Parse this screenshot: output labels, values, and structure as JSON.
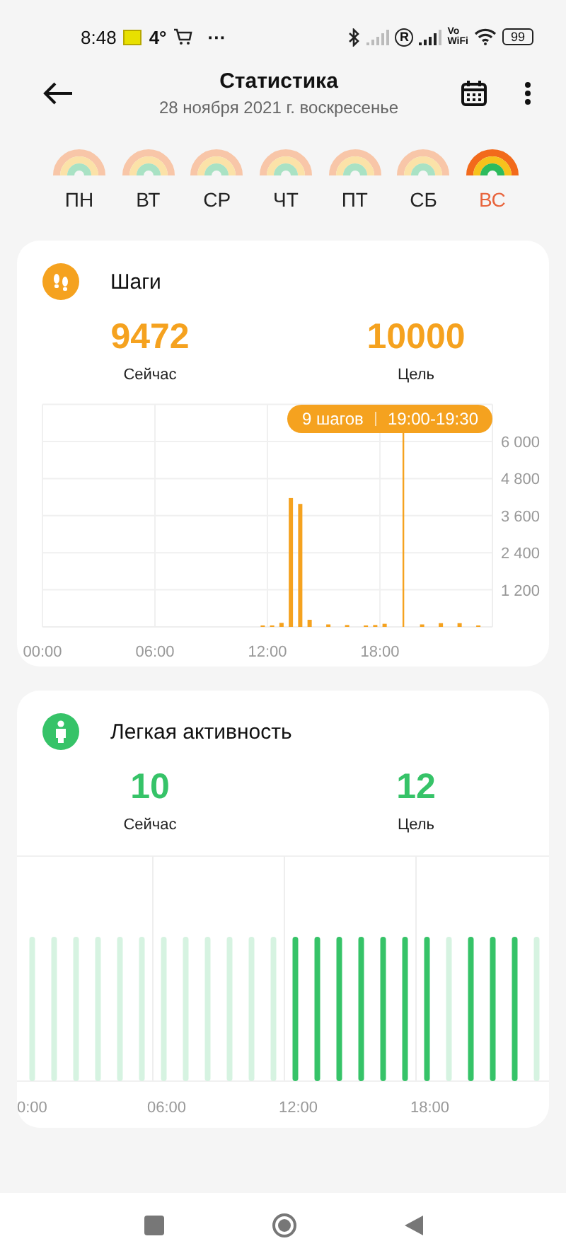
{
  "status_bar": {
    "time": "8:48",
    "temperature": "4°",
    "more": "···",
    "roaming": "R",
    "wifi_calling": [
      "Vo",
      "WiFi"
    ],
    "battery": "99"
  },
  "header": {
    "title": "Статистика",
    "subtitle": "28 ноября 2021 г. воскресенье"
  },
  "week": [
    {
      "label": "ПН",
      "selected": false
    },
    {
      "label": "ВТ",
      "selected": false
    },
    {
      "label": "СР",
      "selected": false
    },
    {
      "label": "ЧТ",
      "selected": false
    },
    {
      "label": "ПТ",
      "selected": false
    },
    {
      "label": "СБ",
      "selected": false
    },
    {
      "label": "ВС",
      "selected": true
    }
  ],
  "cards": [
    {
      "kind": "steps",
      "title": "Шаги",
      "stats": [
        {
          "value": "9472",
          "label": "Сейчас"
        },
        {
          "value": "10000",
          "label": "Цель"
        }
      ],
      "tooltip": {
        "steps": "9 шагов",
        "time": "19:00-19:30"
      },
      "chart_data": {
        "type": "bar",
        "x": [
          11.75,
          12.25,
          12.75,
          13.25,
          13.75,
          14.25,
          15.25,
          16.25,
          17.25,
          17.75,
          18.25,
          20.25,
          21.25,
          22.25,
          23.25
        ],
        "values": [
          20,
          20,
          130,
          4170,
          3980,
          230,
          80,
          60,
          40,
          60,
          100,
          80,
          120,
          120,
          40
        ],
        "xlim": [
          0,
          24
        ],
        "ylim": [
          0,
          7200
        ],
        "grid": true,
        "ref_lines": [
          {
            "axis": "x",
            "value": 19.25
          }
        ],
        "xticks": [
          {
            "value": 0,
            "label": "00:00"
          },
          {
            "value": 6,
            "label": "06:00"
          },
          {
            "value": 12,
            "label": "12:00"
          },
          {
            "value": 18,
            "label": "18:00"
          }
        ],
        "yticks": [
          {
            "value": 1200,
            "label": "1 200"
          },
          {
            "value": 2400,
            "label": "2 400"
          },
          {
            "value": 3600,
            "label": "3 600"
          },
          {
            "value": 4800,
            "label": "4 800"
          },
          {
            "value": 6000,
            "label": "6 000"
          }
        ]
      }
    },
    {
      "kind": "activity",
      "title": "Легкая активность",
      "stats": [
        {
          "value": "10",
          "label": "Сейчас"
        },
        {
          "value": "12",
          "label": "Цель"
        }
      ],
      "hours": [
        {
          "active": false
        },
        {
          "active": false
        },
        {
          "active": false
        },
        {
          "active": false
        },
        {
          "active": false
        },
        {
          "active": false
        },
        {
          "active": false
        },
        {
          "active": false
        },
        {
          "active": false
        },
        {
          "active": false
        },
        {
          "active": false
        },
        {
          "active": false
        },
        {
          "active": true
        },
        {
          "active": true
        },
        {
          "active": true
        },
        {
          "active": true
        },
        {
          "active": true
        },
        {
          "active": true
        },
        {
          "active": true
        },
        {
          "active": false
        },
        {
          "active": true
        },
        {
          "active": true
        },
        {
          "active": true
        },
        {
          "active": false
        }
      ],
      "axis_labels": [
        "0:00",
        "06:00",
        "12:00",
        "18:00"
      ]
    }
  ]
}
